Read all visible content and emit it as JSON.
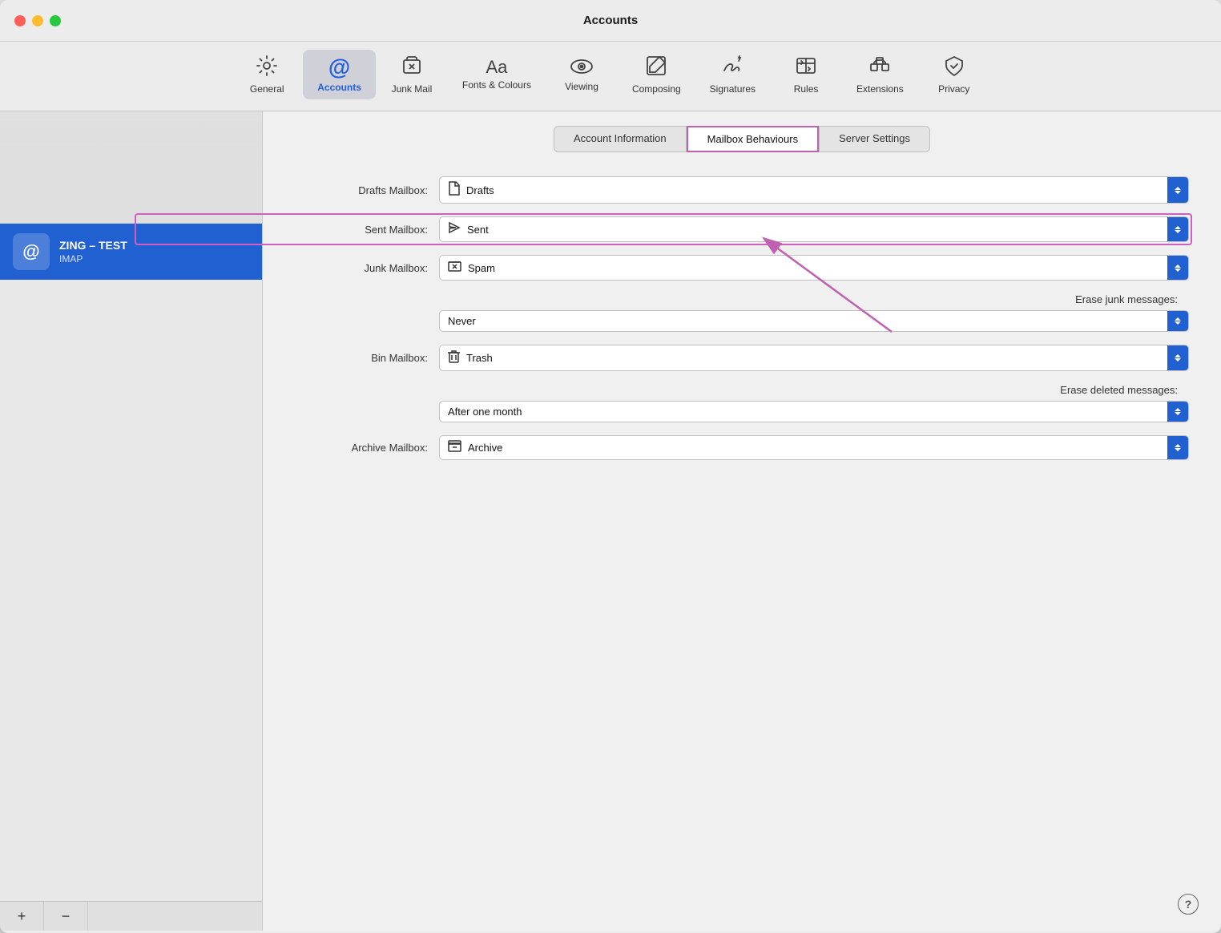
{
  "window": {
    "title": "Accounts",
    "buttons": {
      "close": "close",
      "minimize": "minimize",
      "maximize": "maximize"
    }
  },
  "toolbar": {
    "items": [
      {
        "id": "general",
        "label": "General",
        "icon": "⚙️"
      },
      {
        "id": "accounts",
        "label": "Accounts",
        "icon": "@",
        "active": true
      },
      {
        "id": "junk-mail",
        "label": "Junk Mail",
        "icon": "🗑"
      },
      {
        "id": "fonts-colours",
        "label": "Fonts & Colours",
        "icon": "Aa"
      },
      {
        "id": "viewing",
        "label": "Viewing",
        "icon": "👓"
      },
      {
        "id": "composing",
        "label": "Composing",
        "icon": "✏️"
      },
      {
        "id": "signatures",
        "label": "Signatures",
        "icon": "✍️"
      },
      {
        "id": "rules",
        "label": "Rules",
        "icon": "📨"
      },
      {
        "id": "extensions",
        "label": "Extensions",
        "icon": "🧩"
      },
      {
        "id": "privacy",
        "label": "Privacy",
        "icon": "✋"
      }
    ]
  },
  "sidebar": {
    "accounts": [
      {
        "id": "zing-test",
        "name": "ZING – TEST",
        "type": "IMAP",
        "selected": true
      }
    ],
    "add_button": "+",
    "remove_button": "−"
  },
  "tabs": [
    {
      "id": "account-information",
      "label": "Account Information",
      "active": false
    },
    {
      "id": "mailbox-behaviours",
      "label": "Mailbox Behaviours",
      "active": true
    },
    {
      "id": "server-settings",
      "label": "Server Settings",
      "active": false
    }
  ],
  "form": {
    "drafts_mailbox_label": "Drafts Mailbox:",
    "drafts_mailbox_icon": "📄",
    "drafts_mailbox_value": "Drafts",
    "sent_mailbox_label": "Sent Mailbox:",
    "sent_mailbox_icon": "➤",
    "sent_mailbox_value": "Sent",
    "junk_mailbox_label": "Junk Mailbox:",
    "junk_mailbox_icon": "⊠",
    "junk_mailbox_value": "Spam",
    "erase_junk_label": "Erase junk messages:",
    "erase_junk_value": "Never",
    "bin_mailbox_label": "Bin Mailbox:",
    "bin_mailbox_icon": "🗑",
    "bin_mailbox_value": "Trash",
    "erase_deleted_label": "Erase deleted messages:",
    "erase_deleted_value": "After one month",
    "archive_mailbox_label": "Archive Mailbox:",
    "archive_mailbox_icon": "⊟",
    "archive_mailbox_value": "Archive"
  },
  "help": "?"
}
